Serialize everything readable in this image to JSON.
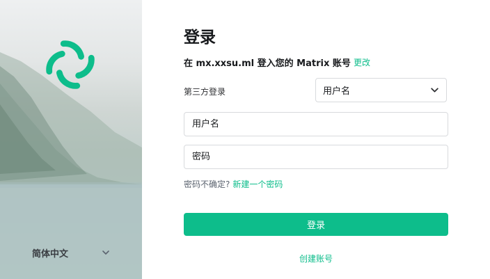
{
  "sidebar": {
    "language": "简体中文",
    "logo_icon": "element-logo-icon",
    "chevron_icon": "chevron-down-icon",
    "accent": "#0dbd8b"
  },
  "login": {
    "title": "登录",
    "server_text": "在 mx.xxsu.ml 登入您的 Matrix 账号",
    "change_link": "更改",
    "sso_label": "第三方登录",
    "login_type": "用户名",
    "username_placeholder": "用户名",
    "password_placeholder": "密码",
    "forgot_text": "密码不确定?",
    "forgot_link": "新建一个密码",
    "submit_label": "登录",
    "create_account": "创建账号"
  },
  "colors": {
    "accent": "#0dbd8b",
    "text": "#17191c",
    "border": "#d8dadd"
  }
}
